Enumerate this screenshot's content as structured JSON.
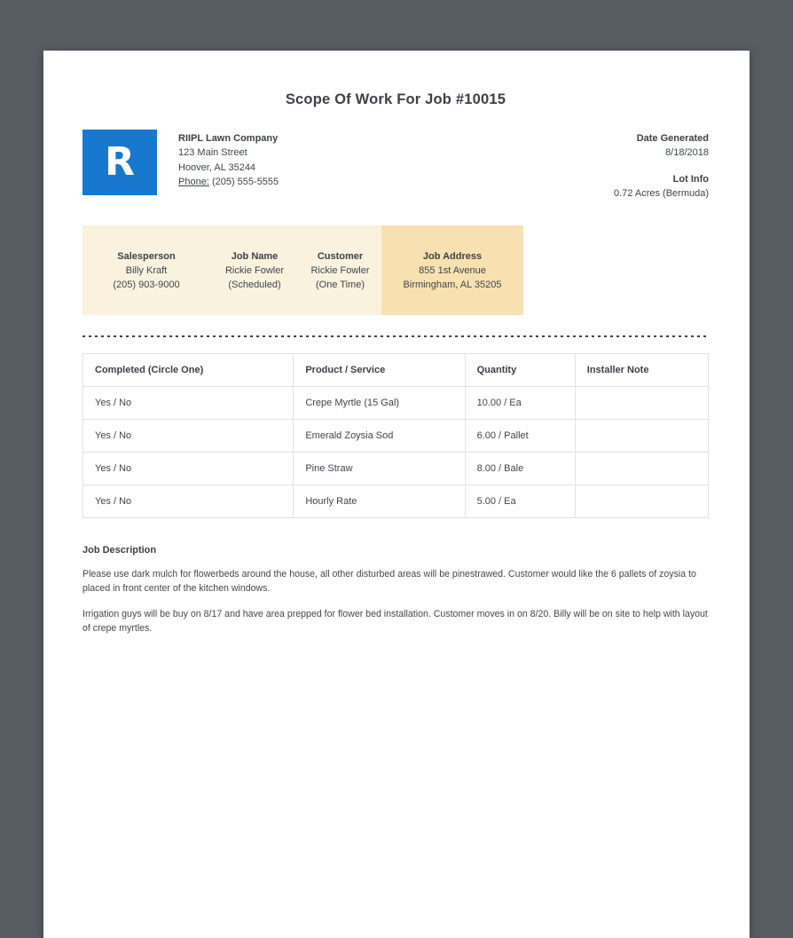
{
  "page": {
    "title": "Scope Of Work For Job #10015"
  },
  "company": {
    "logo_letter": "R",
    "name": "RIIPL Lawn Company",
    "address_line1": "123 Main Street",
    "address_line2": "Hoover, AL 35244",
    "phone_label": "Phone:",
    "phone": "(205) 555-5555"
  },
  "meta": {
    "date_generated_label": "Date Generated",
    "date_generated": "8/18/2018",
    "lot_info_label": "Lot Info",
    "lot_info": "0.72 Acres (Bermuda)"
  },
  "info_band": {
    "columns": [
      {
        "label": "Salesperson",
        "line1": "Billy Kraft",
        "line2": "(205) 903-9000"
      },
      {
        "label": "Job Name",
        "line1": "Rickie Fowler",
        "line2": "(Scheduled)"
      },
      {
        "label": "Customer",
        "line1": "Rickie Fowler",
        "line2": "(One Time)"
      },
      {
        "label": "Job Address",
        "line1": "855 1st Avenue",
        "line2": "Birmingham, AL 35205"
      }
    ]
  },
  "work_table": {
    "headers": [
      "Completed (Circle One)",
      "Product / Service",
      "Quantity",
      "Installer Note"
    ],
    "rows": [
      [
        "Yes / No",
        "Crepe Myrtle (15 Gal)",
        "10.00 / Ea",
        ""
      ],
      [
        "Yes / No",
        "Emerald Zoysia Sod",
        "6.00 / Pallet",
        ""
      ],
      [
        "Yes / No",
        "Pine Straw",
        "8.00 / Bale",
        ""
      ],
      [
        "Yes / No",
        "Hourly Rate",
        "5.00 / Ea",
        ""
      ]
    ]
  },
  "job_description": {
    "heading": "Job Description",
    "paragraph1": "Please use dark mulch for flowerbeds around the house, all other disturbed areas will be pinestrawed. Customer would like the 6 pallets of zoysia to placed in front center of the kitchen windows.",
    "paragraph2": "Irrigation guys will be buy on 8/17 and have area prepped for flower bed installation. Customer moves in on 8/20. Billy will be on site to help with layout of crepe myrtles."
  },
  "colors": {
    "accent_blue": "#1878cd",
    "band_bg": "#fbf2de",
    "band_highlight_bg": "#f7e1b0",
    "canvas_bg": "#585d64"
  }
}
